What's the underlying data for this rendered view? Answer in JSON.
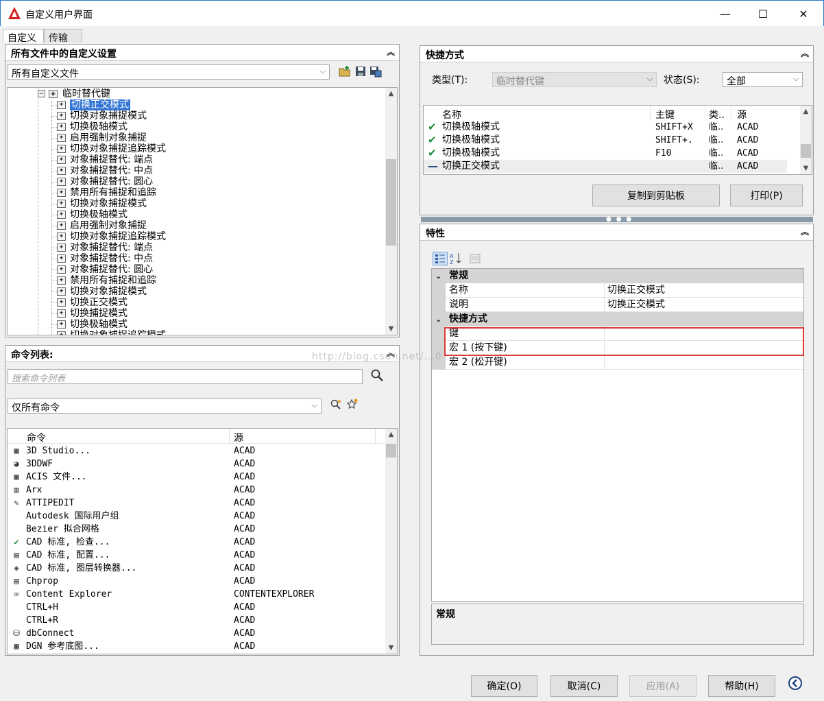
{
  "window": {
    "title": "自定义用户界面",
    "minimize": "—",
    "maximize": "☐",
    "close": "✕"
  },
  "tabs": [
    {
      "label": "自定义"
    },
    {
      "label": "传输"
    }
  ],
  "customize_panel": {
    "title": "所有文件中的自定义设置",
    "file_combo": "所有自定义文件",
    "tree_root": "临时替代键",
    "tree_items": [
      "切换正交模式",
      "切换对象捕捉模式",
      "切换极轴模式",
      "启用强制对象捕捉",
      "切换对象捕捉追踪模式",
      "对象捕捉替代: 端点",
      "对象捕捉替代: 中点",
      "对象捕捉替代: 圆心",
      "禁用所有捕捉和追踪",
      "切换对象捕捉模式",
      "切换极轴模式",
      "启用强制对象捕捉",
      "切换对象捕捉追踪模式",
      "对象捕捉替代: 端点",
      "对象捕捉替代: 中点",
      "对象捕捉替代: 圆心",
      "禁用所有捕捉和追踪",
      "切换对象捕捉模式",
      "切换正交模式",
      "切换捕捉模式",
      "切换极轴模式",
      "切换对象捕捉追踪模式"
    ]
  },
  "command_panel": {
    "title": "命令列表:",
    "search_placeholder": "搜索命令列表",
    "filter_combo": "仅所有命令",
    "columns": [
      "命令",
      "源"
    ],
    "rows": [
      {
        "name": "3D Studio...",
        "source": "ACAD",
        "icon": "▦"
      },
      {
        "name": "3DDWF",
        "source": "ACAD",
        "icon": "◕"
      },
      {
        "name": "ACIS 文件...",
        "source": "ACAD",
        "icon": "▦"
      },
      {
        "name": "Arx",
        "source": "ACAD",
        "icon": "▥"
      },
      {
        "name": "ATTIPEDIT",
        "source": "ACAD",
        "icon": "✎"
      },
      {
        "name": "Autodesk 国际用户组",
        "source": "ACAD",
        "icon": ""
      },
      {
        "name": "Bezier 拟合网格",
        "source": "ACAD",
        "icon": ""
      },
      {
        "name": "CAD 标准, 检查...",
        "source": "ACAD",
        "icon": "✔"
      },
      {
        "name": "CAD 标准, 配置...",
        "source": "ACAD",
        "icon": "▤"
      },
      {
        "name": "CAD 标准, 图层转换器...",
        "source": "ACAD",
        "icon": "◈"
      },
      {
        "name": "Chprop",
        "source": "ACAD",
        "icon": "▤"
      },
      {
        "name": "Content Explorer",
        "source": "CONTENTEXPLORER",
        "icon": "∞"
      },
      {
        "name": "CTRL+H",
        "source": "ACAD",
        "icon": ""
      },
      {
        "name": "CTRL+R",
        "source": "ACAD",
        "icon": ""
      },
      {
        "name": "dbConnect",
        "source": "ACAD",
        "icon": "⛁"
      },
      {
        "name": "DGN 参考底图...",
        "source": "ACAD",
        "icon": "▦"
      }
    ]
  },
  "shortcuts_panel": {
    "title": "快捷方式",
    "type_label": "类型(T):",
    "type_value": "临时替代键",
    "status_label": "状态(S):",
    "status_value": "全部",
    "columns": [
      "名称",
      "主键",
      "类..",
      "源"
    ],
    "rows": [
      {
        "mark": "✔",
        "name": "切换极轴模式",
        "key": "SHIFT+X",
        "type": "临..",
        "source": "ACAD"
      },
      {
        "mark": "✔",
        "name": "切换极轴模式",
        "key": "SHIFT+.",
        "type": "临..",
        "source": "ACAD"
      },
      {
        "mark": "✔",
        "name": "切换极轴模式",
        "key": "F10",
        "type": "临..",
        "source": "ACAD"
      },
      {
        "mark": "—",
        "name": "切换正交模式",
        "key": "",
        "type": "临..",
        "source": "ACAD"
      }
    ],
    "copy_button": "复制到剪贴板",
    "print_button": "打印(P)"
  },
  "properties_panel": {
    "title": "特性",
    "cat_general": "常规",
    "name_label": "名称",
    "name_value": "切换正交模式",
    "desc_label": "说明",
    "desc_value": "切换正交模式",
    "cat_shortcut": "快捷方式",
    "key_label": "键",
    "macro1_label": "宏 1 (按下键)",
    "macro2_label": "宏 2 (松开键)",
    "desc_box_title": "常规"
  },
  "footer": {
    "ok": "确定(O)",
    "cancel": "取消(C)",
    "apply": "应用(A)",
    "help": "帮助(H)"
  },
  "watermark": "http://blog.csdn.net/...0",
  "colors": {
    "selection": "#3375d4",
    "highlight_box": "#e03a3a",
    "check": "#1e8a3c"
  }
}
